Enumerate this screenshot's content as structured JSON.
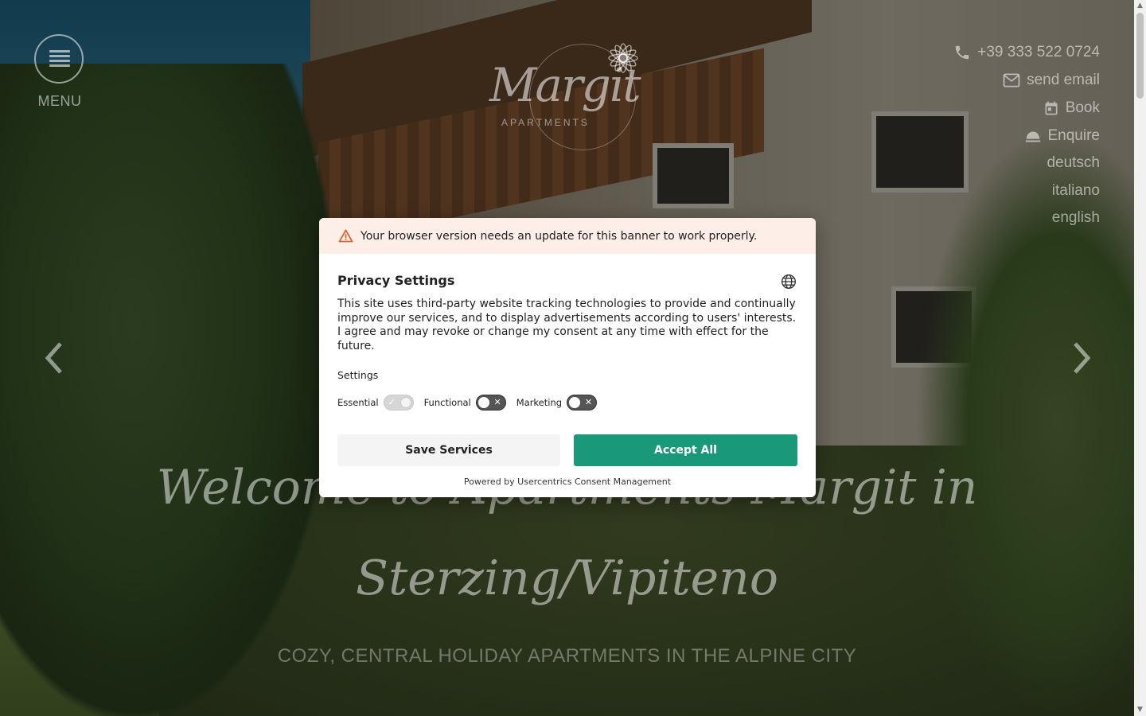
{
  "header": {
    "menu_label": "MENU",
    "logo": {
      "name": "Margit",
      "subtitle": "APARTMENTS"
    },
    "links": [
      {
        "label": "+39 333 522 0724",
        "icon": "phone-icon"
      },
      {
        "label": "send email",
        "icon": "mail-icon"
      },
      {
        "label": "Book",
        "icon": "calendar-icon"
      },
      {
        "label": "Enquire",
        "icon": "bell-icon"
      }
    ],
    "languages": [
      "deutsch",
      "italiano",
      "english"
    ]
  },
  "hero": {
    "title_line1": "Welcome to Apartments Margit in",
    "title_line2": "Sterzing/Vipiteno",
    "subtitle": "COZY, CENTRAL HOLIDAY APARTMENTS IN THE ALPINE CITY"
  },
  "consent": {
    "warning": "Your browser version needs an update for this banner to work properly.",
    "title": "Privacy Settings",
    "description": "This site uses third-party website tracking technologies to provide and continually improve our services, and to display advertisements according to users' interests. I agree and may revoke or change my consent at any time with effect for the future.",
    "settings_label": "Settings",
    "toggles": [
      {
        "label": "Essential",
        "state": "on"
      },
      {
        "label": "Functional",
        "state": "off"
      },
      {
        "label": "Marketing",
        "state": "off"
      }
    ],
    "save_label": "Save Services",
    "accept_label": "Accept All",
    "powered_by": "Powered by Usercentrics Consent Management"
  },
  "colors": {
    "accent": "#19997a",
    "warning_bg": "#fdeee7",
    "warning_icon": "#e05a2b"
  }
}
